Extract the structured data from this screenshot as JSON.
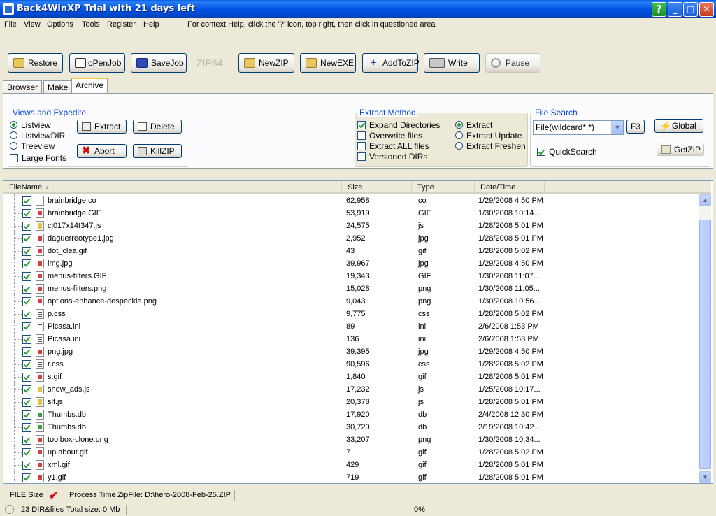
{
  "window": {
    "title": "Back4WinXP Trial with 21 days left",
    "controls": {
      "help": "?",
      "minimize": "_",
      "maximize": "□",
      "close": "✕"
    }
  },
  "menu": {
    "items": [
      "File",
      "View",
      "Options",
      "Tools",
      "Register",
      "Help"
    ],
    "hint": "For context Help, click the '?' icon, top right, then click in questioned area"
  },
  "toolbar": {
    "restore": "Restore",
    "openjob": "oPenJob",
    "savejob": "SaveJob",
    "zip64": "ZIP64",
    "newzip": "NewZIP",
    "newexe": "NewEXE",
    "addtozip": "AddToZIP",
    "write": "Write",
    "pause": "Pause"
  },
  "tabs": [
    "Browser",
    "Make",
    "Archive"
  ],
  "views": {
    "title": "Views and Expedite",
    "options": [
      "Listview",
      "ListviewDIR",
      "Treeview"
    ],
    "selected": "Listview",
    "large_fonts": "Large Fonts",
    "extract": "Extract",
    "delete": "Delete",
    "abort": "Abort",
    "killzip": "KillZIP"
  },
  "extract_method": {
    "title": "Extract Method",
    "checks": [
      {
        "label": "Expand Directories",
        "checked": true
      },
      {
        "label": "Overwrite files",
        "checked": false
      },
      {
        "label": "Extract ALL files",
        "checked": false
      },
      {
        "label": "Versioned DIRs",
        "checked": false
      }
    ],
    "radios": [
      {
        "label": "Extract",
        "selected": true
      },
      {
        "label": "Extract Update",
        "selected": false
      },
      {
        "label": "Extract Freshen",
        "selected": false
      }
    ]
  },
  "file_search": {
    "title": "File Search",
    "combo_value": "File(wildcard*.*)",
    "f3": "F3",
    "global": "Global",
    "getzip": "GetZIP",
    "quicksearch": "QuickSearch"
  },
  "list": {
    "columns": [
      "FileName",
      "Size",
      "Type",
      "Date/Time"
    ],
    "rows": [
      {
        "name": "brainbridge.co",
        "size": "62,958",
        "type": ".co",
        "date": "1/29/2008  4:50 PM",
        "icon": "co"
      },
      {
        "name": "brainbridge.GIF",
        "size": "53,919",
        "type": ".GIF",
        "date": "1/30/2008  10:14...",
        "icon": "gif"
      },
      {
        "name": "cj017x14t347.js",
        "size": "24,575",
        "type": ".js",
        "date": "1/28/2008  5:01 PM",
        "icon": "js"
      },
      {
        "name": "daguerreotype1.jpg",
        "size": "2,952",
        "type": ".jpg",
        "date": "1/28/2008  5:01 PM",
        "icon": "jpg"
      },
      {
        "name": "dot_clea.gif",
        "size": " 43",
        "type": ".gif",
        "date": "1/28/2008  5:02 PM",
        "icon": "gif"
      },
      {
        "name": "img.jpg",
        "size": "39,967",
        "type": ".jpg",
        "date": "1/29/2008  4:50 PM",
        "icon": "jpg"
      },
      {
        "name": "menus-filters.GIF",
        "size": "19,343",
        "type": ".GIF",
        "date": "1/30/2008  11:07...",
        "icon": "gif"
      },
      {
        "name": "menus-filters.png",
        "size": "15,028",
        "type": ".png",
        "date": "1/30/2008  11:05...",
        "icon": "png"
      },
      {
        "name": "options-enhance-despeckle.png",
        "size": "9,043",
        "type": ".png",
        "date": "1/30/2008  10:56...",
        "icon": "png"
      },
      {
        "name": "p.css",
        "size": "9,775",
        "type": ".css",
        "date": "1/28/2008  5:02 PM",
        "icon": "css"
      },
      {
        "name": "Picasa.ini",
        "size": " 89",
        "type": ".ini",
        "date": "2/6/2008  1:53 PM",
        "icon": "ini"
      },
      {
        "name": "Picasa.ini",
        "size": "136",
        "type": ".ini",
        "date": "2/6/2008  1:53 PM",
        "icon": "ini"
      },
      {
        "name": "png.jpg",
        "size": "39,395",
        "type": ".jpg",
        "date": "1/29/2008  4:50 PM",
        "icon": "jpg"
      },
      {
        "name": "r.css",
        "size": "90,596",
        "type": ".css",
        "date": "1/28/2008  5:02 PM",
        "icon": "css"
      },
      {
        "name": "s.gif",
        "size": "1,840",
        "type": ".gif",
        "date": "1/28/2008  5:01 PM",
        "icon": "gif"
      },
      {
        "name": "show_ads.js",
        "size": "17,232",
        "type": ".js",
        "date": "1/25/2008  10:17...",
        "icon": "js"
      },
      {
        "name": "slf.js",
        "size": "20,378",
        "type": ".js",
        "date": "1/28/2008  5:01 PM",
        "icon": "js"
      },
      {
        "name": "Thumbs.db",
        "size": "17,920",
        "type": ".db",
        "date": "2/4/2008  12:30 PM",
        "icon": "db"
      },
      {
        "name": "Thumbs.db",
        "size": "30,720",
        "type": ".db",
        "date": "2/19/2008  10:42...",
        "icon": "db"
      },
      {
        "name": "toolbox-clone.png",
        "size": "33,207",
        "type": ".png",
        "date": "1/30/2008  10:34...",
        "icon": "png"
      },
      {
        "name": "up.about.gif",
        "size": " 7",
        "type": ".gif",
        "date": "1/28/2008  5:02 PM",
        "icon": "gif"
      },
      {
        "name": "xml.gif",
        "size": "429",
        "type": ".gif",
        "date": "1/28/2008  5:01 PM",
        "icon": "gif"
      },
      {
        "name": "y1.gif",
        "size": "719",
        "type": ".gif",
        "date": "1/28/2008  5:01 PM",
        "icon": "gif"
      }
    ]
  },
  "status": {
    "file_size": "FILE Size",
    "process_time": "Process Time",
    "zipfile": "ZipFile: D:\\hero-2008-Feb-25.ZIP",
    "count": "23 DIR&files",
    "total": "Total size:   0 Mb",
    "percent": "0%"
  }
}
